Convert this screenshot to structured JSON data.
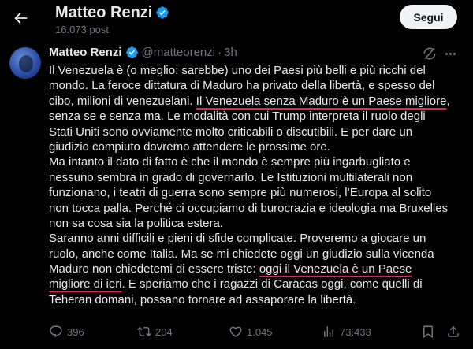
{
  "header": {
    "name": "Matteo Renzi",
    "post_count": "16.073 post",
    "follow_label": "Segui",
    "back_icon": "arrow-left-icon"
  },
  "tweet": {
    "author": "Matteo Renzi",
    "handle": "@matteorenzi",
    "separator": "·",
    "time": "3h",
    "text_lines": [
      [
        {
          "t": "Il Venezuela è (o meglio: sarebbe) uno dei Paesi più belli e più ricchi del"
        }
      ],
      [
        {
          "t": "mondo. La feroce dittatura di Maduro ha privato della libertà, e spesso del"
        }
      ],
      [
        {
          "t": "cibo, milioni di venezuelani. "
        },
        {
          "t": "Il Venezuela senza Maduro è un Paese migliore",
          "u": true
        },
        {
          "t": ","
        }
      ],
      [
        {
          "t": "senza se e senza ma. Le modalità con cui Trump interpreta il ruolo degli"
        }
      ],
      [
        {
          "t": "Stati Uniti sono ovviamente molto criticabili o discutibili. E per dare un"
        }
      ],
      [
        {
          "t": "giudizio compiuto dovremo attendere le prossime ore."
        }
      ],
      [
        {
          "t": "Ma intanto il dato di fatto è che il mondo è sempre più ingarbugliato e"
        }
      ],
      [
        {
          "t": "nessuno sembra in grado di governarlo. Le Istituzioni multilaterali non"
        }
      ],
      [
        {
          "t": "funzionano, i teatri di guerra sono sempre più numerosi, l’Europa al solito"
        }
      ],
      [
        {
          "t": "non tocca palla. Perché ci occupiamo di burocrazia e ideologia ma Bruxelles"
        }
      ],
      [
        {
          "t": "non sa cosa sia la politica estera."
        }
      ],
      [
        {
          "t": "Saranno anni difficili e pieni di sfide complicate. Proveremo a giocare un"
        }
      ],
      [
        {
          "t": "ruolo, anche come Italia. Ma se mi chiedete oggi un giudizio sulla vicenda"
        }
      ],
      [
        {
          "t": "Maduro non chiedetemi di essere triste: "
        },
        {
          "t": "oggi il Venezuela è un Paese",
          "u": true
        }
      ],
      [
        {
          "t": "migliore di ieri",
          "u": true
        },
        {
          "t": ". E speriamo che i ragazzi di Caracas oggi, come quelli di"
        }
      ],
      [
        {
          "t": "Teheran domani, possano tornare ad assaporare la libertà."
        }
      ]
    ]
  },
  "actions": {
    "replies": "396",
    "retweets": "204",
    "likes": "1.045",
    "views": "73.433"
  },
  "colors": {
    "background": "#000000",
    "text": "#e7e9ea",
    "secondary": "#71767b",
    "verified": "#1d9bf0",
    "underline": "#e0245e"
  }
}
